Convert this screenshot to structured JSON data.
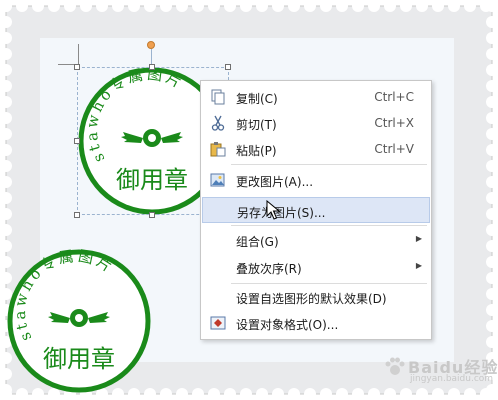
{
  "seal": {
    "arc_text": "stawho专属图片",
    "center_text": "御用章",
    "color": "#1a8a1a"
  },
  "menu": {
    "items": [
      {
        "label": "复制(C)",
        "shortcut": "Ctrl+C",
        "icon": "copy-icon"
      },
      {
        "label": "剪切(T)",
        "shortcut": "Ctrl+X",
        "icon": "cut-icon"
      },
      {
        "label": "粘贴(P)",
        "shortcut": "Ctrl+V",
        "icon": "paste-icon"
      },
      {
        "label": "更改图片(A)...",
        "shortcut": "",
        "icon": "change-picture-icon"
      },
      {
        "label": "另存为图片(S)...",
        "shortcut": "",
        "icon": ""
      },
      {
        "label": "组合(G)",
        "shortcut": "",
        "icon": "",
        "submenu": true
      },
      {
        "label": "叠放次序(R)",
        "shortcut": "",
        "icon": "",
        "submenu": true
      },
      {
        "label": "设置自选图形的默认效果(D)",
        "shortcut": "",
        "icon": ""
      },
      {
        "label": "设置对象格式(O)...",
        "shortcut": "",
        "icon": "format-object-icon"
      }
    ],
    "highlight_color": "#dde6f6"
  },
  "watermark": {
    "text": "Baidu经验",
    "url": "jingyan.baidu.com"
  }
}
